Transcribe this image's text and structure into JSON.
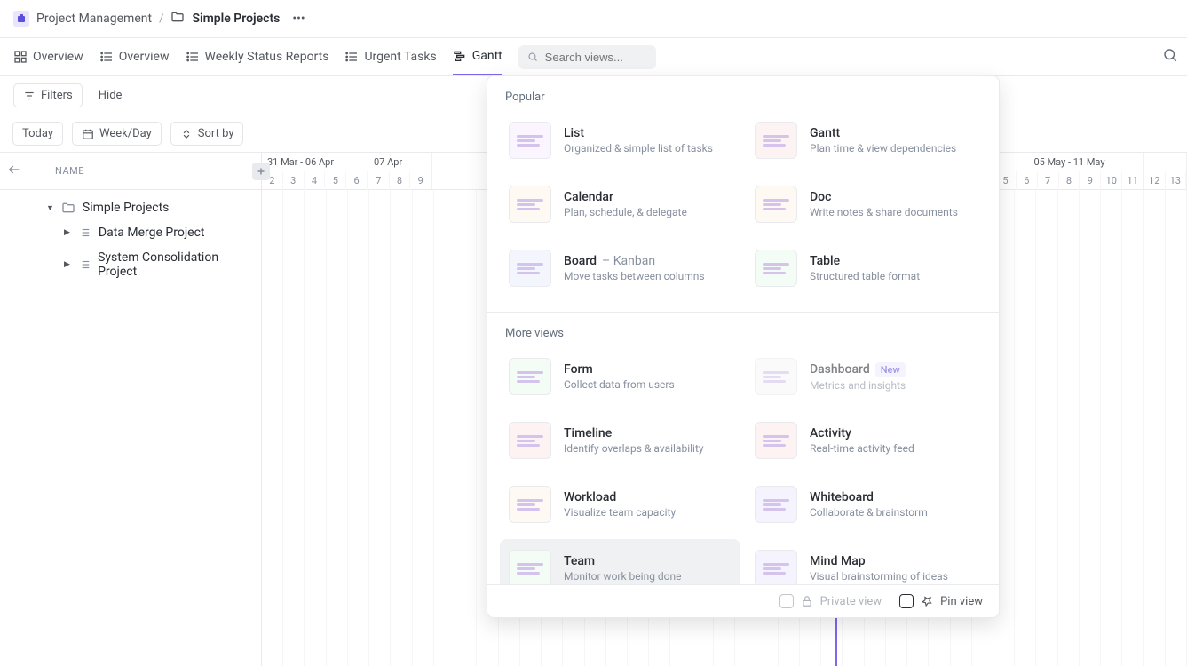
{
  "breadcrumb": {
    "workspace": "Project Management",
    "folder": "Simple Projects"
  },
  "tabs": [
    {
      "label": "Overview",
      "icon": "grid"
    },
    {
      "label": "Overview",
      "icon": "list"
    },
    {
      "label": "Weekly Status Reports",
      "icon": "list"
    },
    {
      "label": "Urgent Tasks",
      "icon": "list"
    },
    {
      "label": "Gantt",
      "icon": "gantt",
      "active": true
    }
  ],
  "search": {
    "placeholder": "Search views..."
  },
  "toolbar": {
    "filters": "Filters",
    "hide": "Hide",
    "today": "Today",
    "weekday": "Week/Day",
    "sortby": "Sort by"
  },
  "gantt": {
    "name_header": "NAME",
    "tree": {
      "root": "Simple Projects",
      "children": [
        "Data Merge Project",
        "System Consolidation Project"
      ]
    },
    "weeks": [
      {
        "label": "31 Mar - 06 Apr",
        "days": [
          "2",
          "3",
          "4",
          "5",
          "6"
        ],
        "partial_left": true
      },
      {
        "label": "07 Apr",
        "days": [
          "7",
          "8",
          "9"
        ],
        "cut": true
      },
      {
        "label": "05 May - 11 May",
        "days": [
          "5",
          "6",
          "7",
          "8",
          "9",
          "10",
          "11"
        ],
        "far_right": true
      },
      {
        "label": "",
        "days": [
          "12",
          "13"
        ],
        "edge": true
      }
    ]
  },
  "popup": {
    "section1": "Popular",
    "section2": "More views",
    "views_popular": [
      {
        "title": "List",
        "desc": "Organized & simple list of tasks",
        "thumb": "list"
      },
      {
        "title": "Gantt",
        "desc": "Plan time & view dependencies",
        "thumb": "gantt"
      },
      {
        "title": "Calendar",
        "desc": "Plan, schedule, & delegate",
        "thumb": "cal"
      },
      {
        "title": "Doc",
        "desc": "Write notes & share documents",
        "thumb": "doc"
      },
      {
        "title": "Board",
        "suffix": " – Kanban",
        "desc": "Move tasks between columns",
        "thumb": "board"
      },
      {
        "title": "Table",
        "desc": "Structured table format",
        "thumb": "table"
      }
    ],
    "views_more": [
      {
        "title": "Form",
        "desc": "Collect data from users",
        "thumb": "form"
      },
      {
        "title": "Dashboard",
        "desc": "Metrics and insights",
        "thumb": "dash",
        "badge": "New",
        "disabled": true
      },
      {
        "title": "Timeline",
        "desc": "Identify overlaps & availability",
        "thumb": "timeline"
      },
      {
        "title": "Activity",
        "desc": "Real-time activity feed",
        "thumb": "activity"
      },
      {
        "title": "Workload",
        "desc": "Visualize team capacity",
        "thumb": "workload"
      },
      {
        "title": "Whiteboard",
        "desc": "Collaborate & brainstorm",
        "thumb": "whiteboard"
      },
      {
        "title": "Team",
        "desc": "Monitor work being done",
        "thumb": "team",
        "hovered": true
      },
      {
        "title": "Mind Map",
        "desc": "Visual brainstorming of ideas",
        "thumb": "mindmap"
      }
    ],
    "footer": {
      "private": "Private view",
      "pin": "Pin view"
    }
  }
}
